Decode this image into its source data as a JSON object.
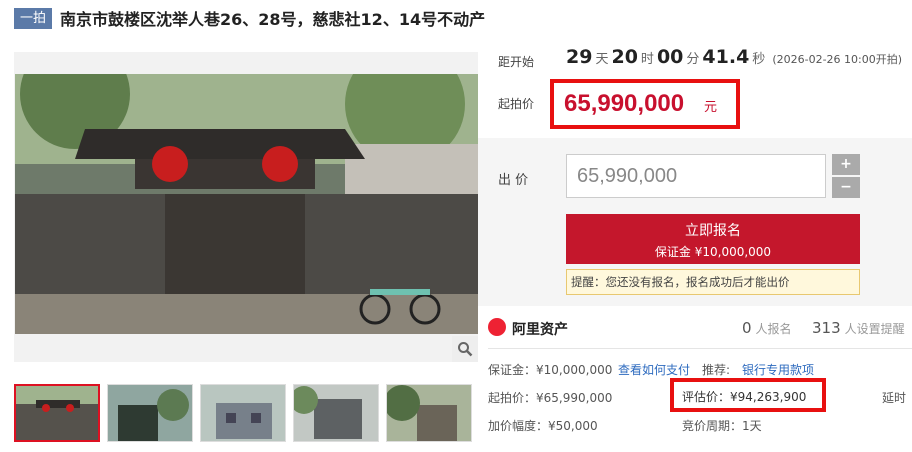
{
  "header": {
    "tag": "一拍",
    "title": "南京市鼓楼区沈举人巷26、28号，慈悲社12、14号不动产"
  },
  "countdown": {
    "label": "距开始",
    "days": "29",
    "days_unit": "天",
    "hours": "20",
    "hours_unit": "时",
    "minutes": "00",
    "minutes_unit": "分",
    "seconds": "41.4",
    "seconds_unit": "秒",
    "schedule": "(2026-02-26 10:00开拍)"
  },
  "start_price": {
    "label": "起拍价",
    "value": "65,990,000",
    "unit": "元"
  },
  "bid": {
    "label": "出 价",
    "input_value": "65,990,000",
    "plus": "+",
    "minus": "−",
    "signup_label": "立即报名",
    "deposit_line": "保证金 ¥10,000,000",
    "tip": "提醒：您还没有报名，报名成功后才能出价"
  },
  "platform": {
    "name": "阿里资产",
    "signups_count": "0",
    "signups_label": "人报名",
    "reminders_count": "313",
    "reminders_label": "人设置提醒"
  },
  "details": {
    "deposit": "保证金：¥10,000,000",
    "how_to_pay": "查看如何支付",
    "recommend_label": "推荐:",
    "bank_payment": "银行专用款项",
    "start_price": "起拍价：¥65,990,000",
    "evaluation": "评估价：¥94,263,900",
    "delay": "延时",
    "increment": "加价幅度：¥50,000",
    "period": "竞价周期：1天"
  },
  "colors": {
    "accent_red": "#c4172c",
    "highlight_border": "#e81010",
    "tag_blue": "#5b7aa8",
    "link_blue": "#2e6bbf"
  },
  "icons": [
    "zoom-icon",
    "alibaba-logo-icon"
  ]
}
